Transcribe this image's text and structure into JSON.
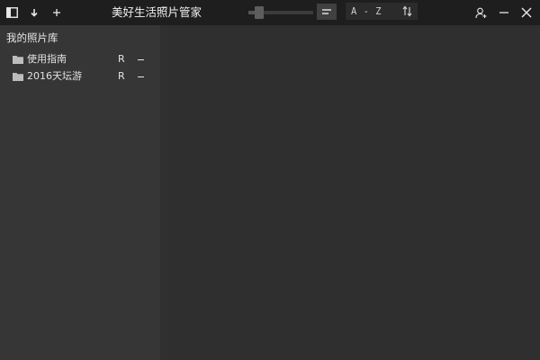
{
  "window": {
    "title": "美好生活照片管家"
  },
  "toolbar": {
    "icons": [
      "sidebar-toggle-icon",
      "import-icon",
      "add-icon"
    ],
    "zoom": 0.12,
    "sort_label": "A - Z",
    "sort_icon": "sort-icon",
    "view_icon": "list-view-icon"
  },
  "window_controls": {
    "icons": [
      "user-add-icon",
      "minimize-icon",
      "close-icon"
    ]
  },
  "sidebar": {
    "title": "我的照片库",
    "albums": [
      {
        "label": "使用指南",
        "rename": "R"
      },
      {
        "label": "2016天坛游",
        "rename": "R"
      }
    ]
  },
  "colors": {
    "titlebar": "#1e1e1e",
    "sidebar": "#363636",
    "main": "#2f2f2f",
    "text": "#e6e6e6",
    "folder": "#bdbdbd"
  }
}
